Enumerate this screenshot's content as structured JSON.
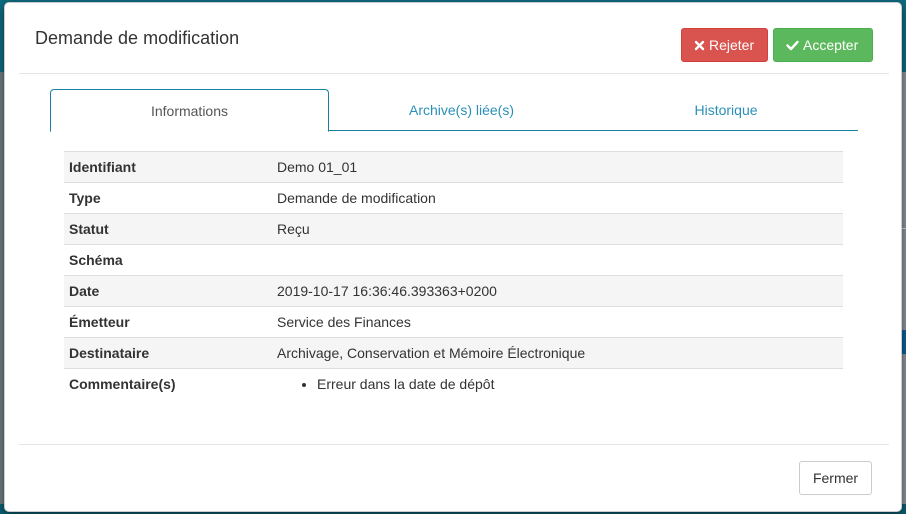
{
  "modal": {
    "title": "Demande de modification",
    "reject_label": "Rejeter",
    "accept_label": "Accepter",
    "close_label": "Fermer"
  },
  "tabs": [
    {
      "label": "Informations",
      "active": true
    },
    {
      "label": "Archive(s) liée(s)",
      "active": false
    },
    {
      "label": "Historique",
      "active": false
    }
  ],
  "details": {
    "rows": [
      {
        "label": "Identifiant",
        "value": "Demo 01_01"
      },
      {
        "label": "Type",
        "value": "Demande de modification"
      },
      {
        "label": "Statut",
        "value": "Reçu"
      },
      {
        "label": "Schéma",
        "value": ""
      },
      {
        "label": "Date",
        "value": "2019-10-17 16:36:46.393363+0200"
      },
      {
        "label": "Émetteur",
        "value": "Service des Finances"
      },
      {
        "label": "Destinataire",
        "value": "Archivage, Conservation et Mémoire Électronique"
      }
    ],
    "comments_label": "Commentaire(s)",
    "comments": [
      "Erreur dans la date de dépôt"
    ]
  },
  "colors": {
    "reject": "#d9534f",
    "accept": "#5cb85c",
    "tab_link": "#2a8fb8",
    "tab_border": "#1a7fa0"
  },
  "icons": {
    "reject": "times-icon",
    "accept": "check-icon"
  }
}
